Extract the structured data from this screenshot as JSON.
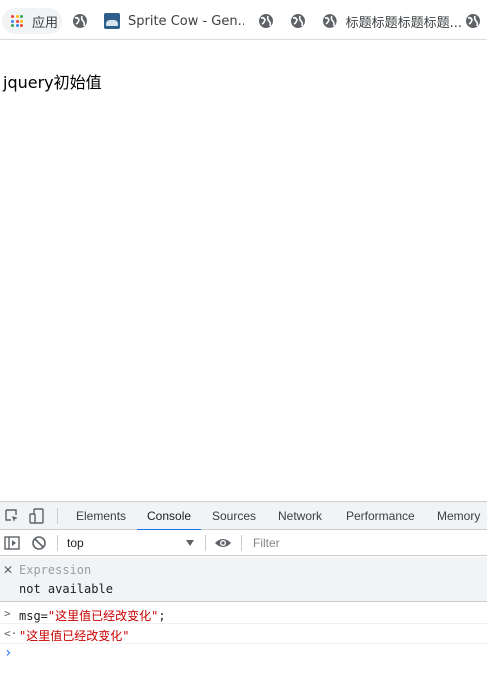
{
  "bookmarks": {
    "apps_label": "应用",
    "sprite_label": "Sprite Cow - Gen...",
    "title_label": "标题标题标题标题..."
  },
  "page": {
    "heading": "jquery初始值"
  },
  "devtools": {
    "tabs": [
      "Elements",
      "Console",
      "Sources",
      "Network",
      "Performance",
      "Memory"
    ],
    "active_tab": "Console",
    "context": "top",
    "filter_placeholder": "Filter",
    "expression_label": "Expression",
    "expression_value": "not available",
    "input_prefix": "msg=",
    "input_string": "\"这里值已经改变化\"",
    "input_suffix": ";",
    "result": "\"这里值已经改变化\""
  },
  "colors": {
    "accent": "#1a73e8",
    "string_red": "#c80000",
    "toolbar_bg": "#f1f3f4"
  },
  "icons": [
    "apps-grid-icon",
    "globe-icon",
    "sprite-cow-favicon",
    "inspect-element-icon",
    "device-toolbar-icon",
    "sidebar-toggle-icon",
    "clear-console-icon",
    "eye-icon",
    "close-icon",
    "chevron-right-icon"
  ]
}
